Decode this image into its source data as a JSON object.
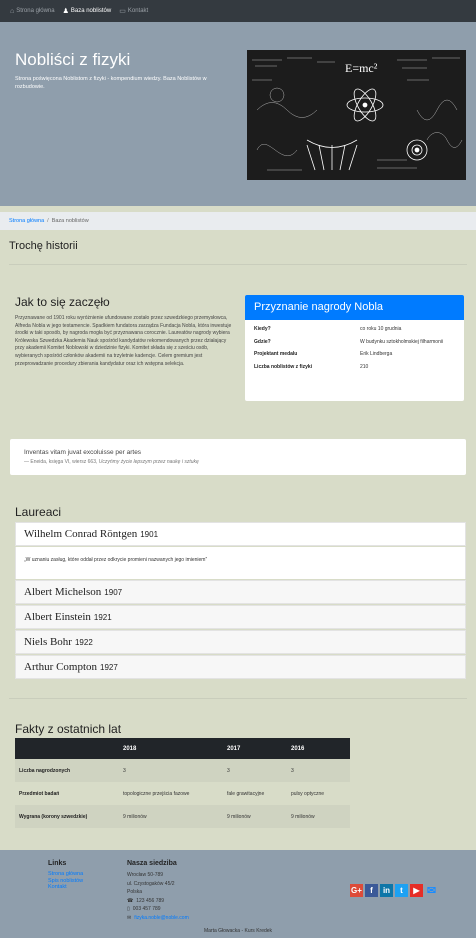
{
  "nav": {
    "items": [
      {
        "label": "Strona główna",
        "icon": "home-icon"
      },
      {
        "label": "Baza noblistów",
        "icon": "person-icon"
      },
      {
        "label": "Kontakt",
        "icon": "contact-card-icon"
      }
    ]
  },
  "hero": {
    "title": "Nobliści z fizyki",
    "subtitle": "Strona poświęcona Noblistom z fizyki - kompendium wiedzy. Baza Noblistów w rozbudowie.",
    "image_formula": "E=mc²"
  },
  "breadcrumb": {
    "home": "Strona główna",
    "separator": "/",
    "current": "Baza noblistów"
  },
  "history_heading": "Trochę historii",
  "history": {
    "title": "Jak to się zaczęło",
    "text": "Przyznawane od 1901 roku wyróżnienie ufundowane zostało przez szwedzkiego przemysłowca, Alfreda Nobla w jego testamencie. Spadkiem fundatora zarządza Fundacja Nobla, która inwestuje środki w taki sposób, by nagroda mogła być przyznawana corocznie. Laureatów nagrody wybiera Królewska Szwedzka Akademia Nauk spośród kandydatów rekomendowanych przez działający przy akademii Komitet Noblowski w dziedzinie fizyki. Komitet składa się z sześciu osób, wybieranych spośród członków akademii na trzyletnie kadencje. Celem gremium jest przeprowadzanie procedury zbierania kandydatur oraz ich wstępna selekcja."
  },
  "prize": {
    "title": "Przyznanie nagrody Nobla",
    "rows": [
      {
        "key": "Kiedy?",
        "value": "co roku 10 grudnia"
      },
      {
        "key": "Gdzie?",
        "value": "W budynku sztokholmskiej filharmonii"
      },
      {
        "key": "Projektant medalu",
        "value": "Erik Lindberga"
      },
      {
        "key": "Liczba noblistów z fizyki",
        "value": "210"
      }
    ]
  },
  "quote": {
    "text": "Inventas vitam juvat excoluisse per artes",
    "source": "— Eneida, księga VI, wiersz 663,",
    "translation": "Uczyńmy życie lepszym przez naukę i sztukę"
  },
  "laureates": {
    "title": "Laureaci",
    "expanded_quote": "„W uznaniu zasług, które oddał przez odkrycie promieni nazwanych jego imieniem”",
    "items": [
      {
        "name": "Wilhelm Conrad Röntgen",
        "year": "1901"
      },
      {
        "name": "Albert Michelson",
        "year": "1907"
      },
      {
        "name": "Albert Einstein",
        "year": "1921"
      },
      {
        "name": "Niels Bohr",
        "year": "1922"
      },
      {
        "name": "Arthur Compton",
        "year": "1927"
      }
    ]
  },
  "facts": {
    "title": "Fakty z ostatnich lat",
    "columns": [
      "",
      "2018",
      "2017",
      "2016"
    ],
    "rows": [
      {
        "label": "Liczba nagrodzonych",
        "values": [
          "3",
          "3",
          "3"
        ]
      },
      {
        "label": "Przedmiot badań",
        "values": [
          "topologiczne przejścia fazowe",
          "fale grawitacyjne",
          "pulsy optyczne"
        ]
      },
      {
        "label": "Wygrana (korony szwedzkie)",
        "values": [
          "9 milionów",
          "9 milionów",
          "9 milionów"
        ]
      }
    ]
  },
  "footer": {
    "links_title": "Links",
    "links": [
      "Strona główna",
      "Spis noblistów",
      "Kontakt"
    ],
    "address_title": "Nasza siedziba",
    "address": [
      "Wrocław 50-789",
      "ul. Czystogaków 45/2",
      "Polska"
    ],
    "phones": [
      "123 456 789",
      "003 457 789"
    ],
    "email": "fizyka.noble@noble.com",
    "copyright": "Marta Głowacka - Kurs Kredek",
    "social": [
      {
        "icon": "google-plus-icon",
        "glyph": "G+",
        "color": "#dd4b39"
      },
      {
        "icon": "facebook-icon",
        "glyph": "f",
        "color": "#3b5998"
      },
      {
        "icon": "linkedin-icon",
        "glyph": "in",
        "color": "#0e76a8"
      },
      {
        "icon": "twitter-icon",
        "glyph": "t",
        "color": "#1da1f2"
      },
      {
        "icon": "youtube-icon",
        "glyph": "▶",
        "color": "#e52d27"
      },
      {
        "icon": "email-icon",
        "glyph": "✉",
        "color": "#1a8cff"
      }
    ]
  }
}
